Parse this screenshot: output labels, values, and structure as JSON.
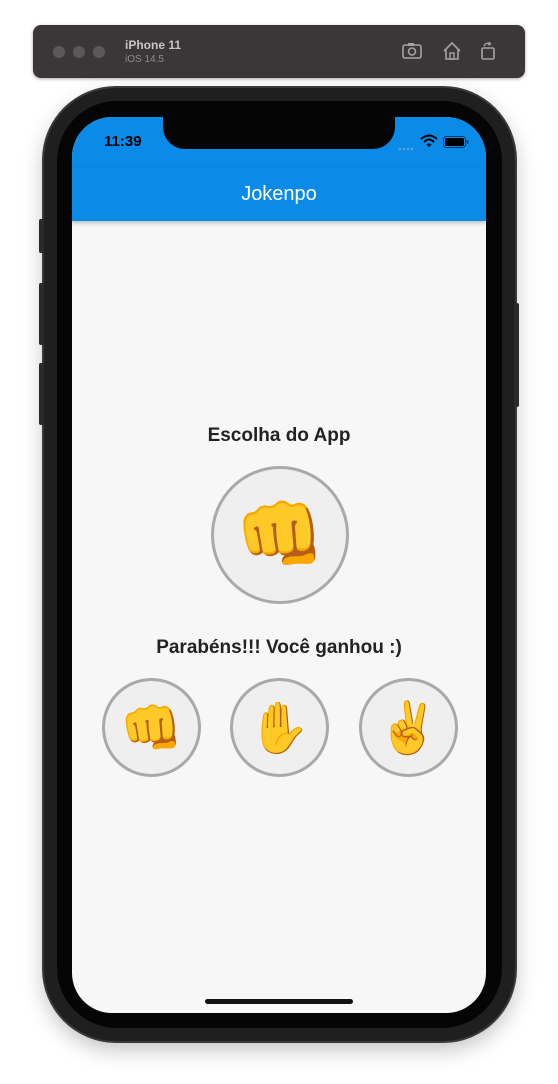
{
  "simulator": {
    "device_name": "iPhone 11",
    "os_version": "iOS 14.5",
    "icons": [
      "screenshot-icon",
      "home-icon",
      "rotate-icon"
    ]
  },
  "status_bar": {
    "time": "11:39",
    "icons": [
      "signal-icon",
      "wifi-icon",
      "battery-icon"
    ]
  },
  "app_bar": {
    "title": "Jokenpo"
  },
  "main": {
    "app_choice_label": "Escolha do App",
    "app_choice_emoji": "👊",
    "result_text": "Parabéns!!! Você ganhou :)",
    "options": [
      {
        "name": "pedra",
        "emoji": "👊"
      },
      {
        "name": "papel",
        "emoji": "✋"
      },
      {
        "name": "tesoura",
        "emoji": "✌️"
      }
    ]
  },
  "colors": {
    "app_bar": "#0a8be8",
    "background": "#f7f7f7",
    "circle_border": "#a9a9a9"
  }
}
